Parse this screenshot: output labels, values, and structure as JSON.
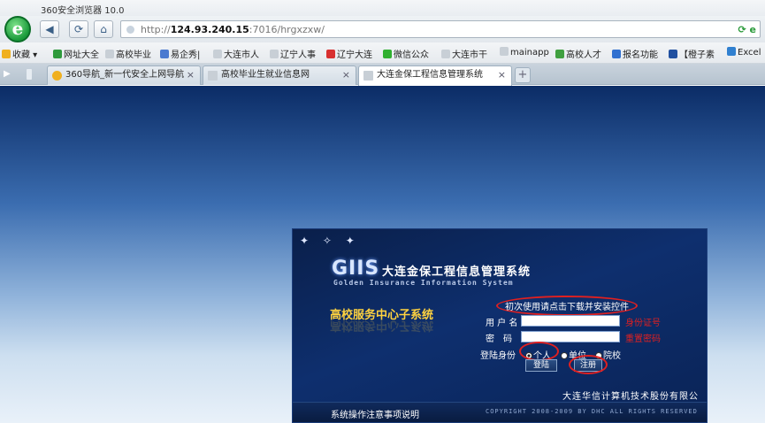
{
  "browser": {
    "title": "360安全浏览器 10.0",
    "url_prefix": "http://",
    "url_host": "124.93.240.15",
    "url_rest": ":7016/hrgxzxw/",
    "url_right_icons": "⟳ e"
  },
  "bookmarks": [
    {
      "label": "收藏 ▾",
      "color": "#f0b020"
    },
    {
      "label": "网址大全",
      "color": "#2e9a3c"
    },
    {
      "label": "高校毕业",
      "color": "#c8cfd6"
    },
    {
      "label": "易企秀|",
      "color": "#4a7ad0"
    },
    {
      "label": "大连市人",
      "color": "#c8cfd6"
    },
    {
      "label": "辽宁人事",
      "color": "#c8cfd6"
    },
    {
      "label": "辽宁大连",
      "color": "#d83030"
    },
    {
      "label": "微信公众",
      "color": "#30b030"
    },
    {
      "label": "大连市干",
      "color": "#c8cfd6"
    },
    {
      "label": "mainapp",
      "color": "#c8cfd6"
    },
    {
      "label": "高校人才",
      "color": "#40a040"
    },
    {
      "label": "报名功能",
      "color": "#3070d0"
    },
    {
      "label": "【橙子素",
      "color": "#2050a0"
    },
    {
      "label": "Excel",
      "color": "#3080d0"
    }
  ],
  "tabs": [
    {
      "label": "360导航_新一代安全上网导航",
      "icon_color": "#f0b020"
    },
    {
      "label": "高校毕业生就业信息网",
      "icon_color": "#c8cfd6"
    },
    {
      "label": "大连金保工程信息管理系统",
      "icon_color": "#c8cfd6"
    }
  ],
  "tab_close": "×",
  "tab_new": "+",
  "login": {
    "stars": "✦ ✧ ✦",
    "logo": "GIIS",
    "system_title": "大连金保工程信息管理系统",
    "system_en": "Golden Insurance Information System",
    "subsystem": "高校服务中心子系统",
    "download_link": "初次使用请点击下载并安装控件",
    "username_label": "用 户 名",
    "username_hint": "身份证号",
    "password_label": "密　码",
    "password_hint": "重置密码",
    "identity_label": "登陆身份",
    "opt_personal": "个人",
    "opt_unit": "单位",
    "opt_school": "院校",
    "login_button": "登陆",
    "register_button": "注册",
    "company": "大连华信计算机技术股份有限公司",
    "notice": "系统操作注意事项说明",
    "copyright": "COPYRIGHT 2008-2009 BY DHC ALL RIGHTS RESERVED"
  }
}
